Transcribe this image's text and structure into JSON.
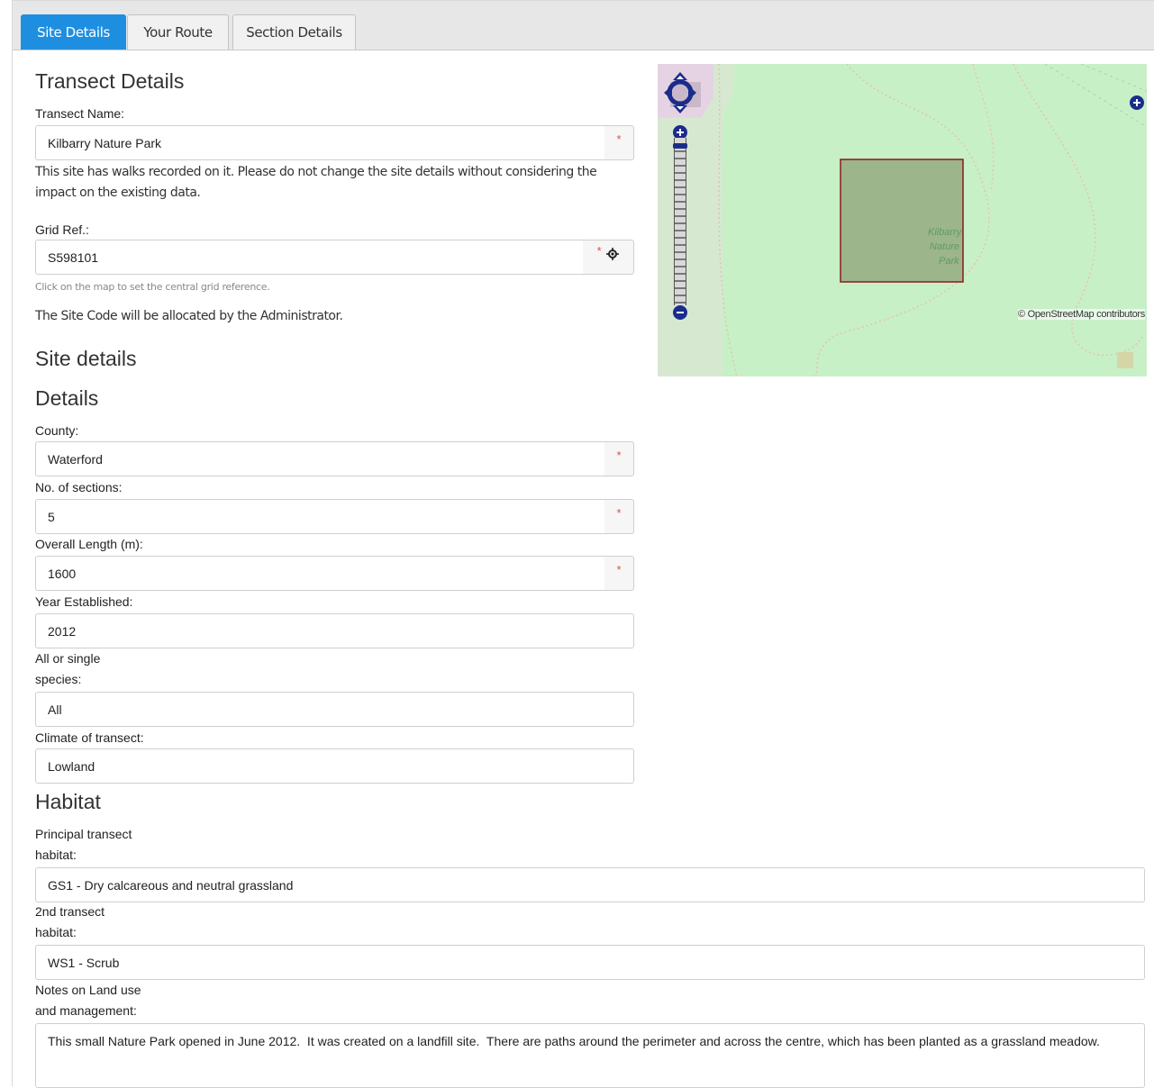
{
  "tabs": [
    "Site Details",
    "Your Route",
    "Section Details"
  ],
  "transect": {
    "heading": "Transect Details",
    "name_label": "Transect Name:",
    "name_value": "Kilbarry Nature Park",
    "warning": "This site has walks recorded on it. Please do not change the site details without considering the impact on the existing data.",
    "grid_label": "Grid Ref.:",
    "grid_value": "S598101",
    "grid_help": "Click on the map to set the central grid reference.",
    "site_code_note": "The Site Code will be allocated by the Administrator."
  },
  "required_marker": "*",
  "site_details_heading": "Site details",
  "details": {
    "heading": "Details",
    "county_label": "County:",
    "county_value": "Waterford",
    "sections_label": "No. of sections:",
    "sections_value": "5",
    "length_label": "Overall Length (m):",
    "length_value": "1600",
    "year_label": "Year Established:",
    "year_value": "2012",
    "species_label_1": "All or single",
    "species_label_2": "species:",
    "species_value": "All",
    "climate_label": "Climate of transect:",
    "climate_value": "Lowland"
  },
  "habitat": {
    "heading": "Habitat",
    "principal_label_1": "Principal transect",
    "principal_label_2": "habitat:",
    "principal_value": "GS1 - Dry calcareous and neutral grassland",
    "second_label_1": "2nd transect",
    "second_label_2": "habitat:",
    "second_value": "WS1 - Scrub",
    "notes_label_1": "Notes on Land use",
    "notes_label_2": "and management:",
    "notes_value": "This small Nature Park opened in June 2012.  It was created on a landfill site.  There are paths around the perimeter and across the centre, which has been planted as a grassland meadow."
  },
  "map": {
    "attribution": "© OpenStreetMap contributors",
    "place_label_1": "Kilbarry",
    "place_label_2": "Nature",
    "place_label_3": "Park"
  },
  "colors": {
    "tab_active": "#1e8fe0",
    "required": "#d9534f",
    "map_bg": "#c7f0c7",
    "polygon_fill": "#9cb58a",
    "polygon_stroke": "#8b1a1a"
  },
  "icons": [
    "crosshair-icon",
    "pan-icon",
    "zoom-in-icon",
    "zoom-out-icon",
    "layer-switcher-icon"
  ]
}
